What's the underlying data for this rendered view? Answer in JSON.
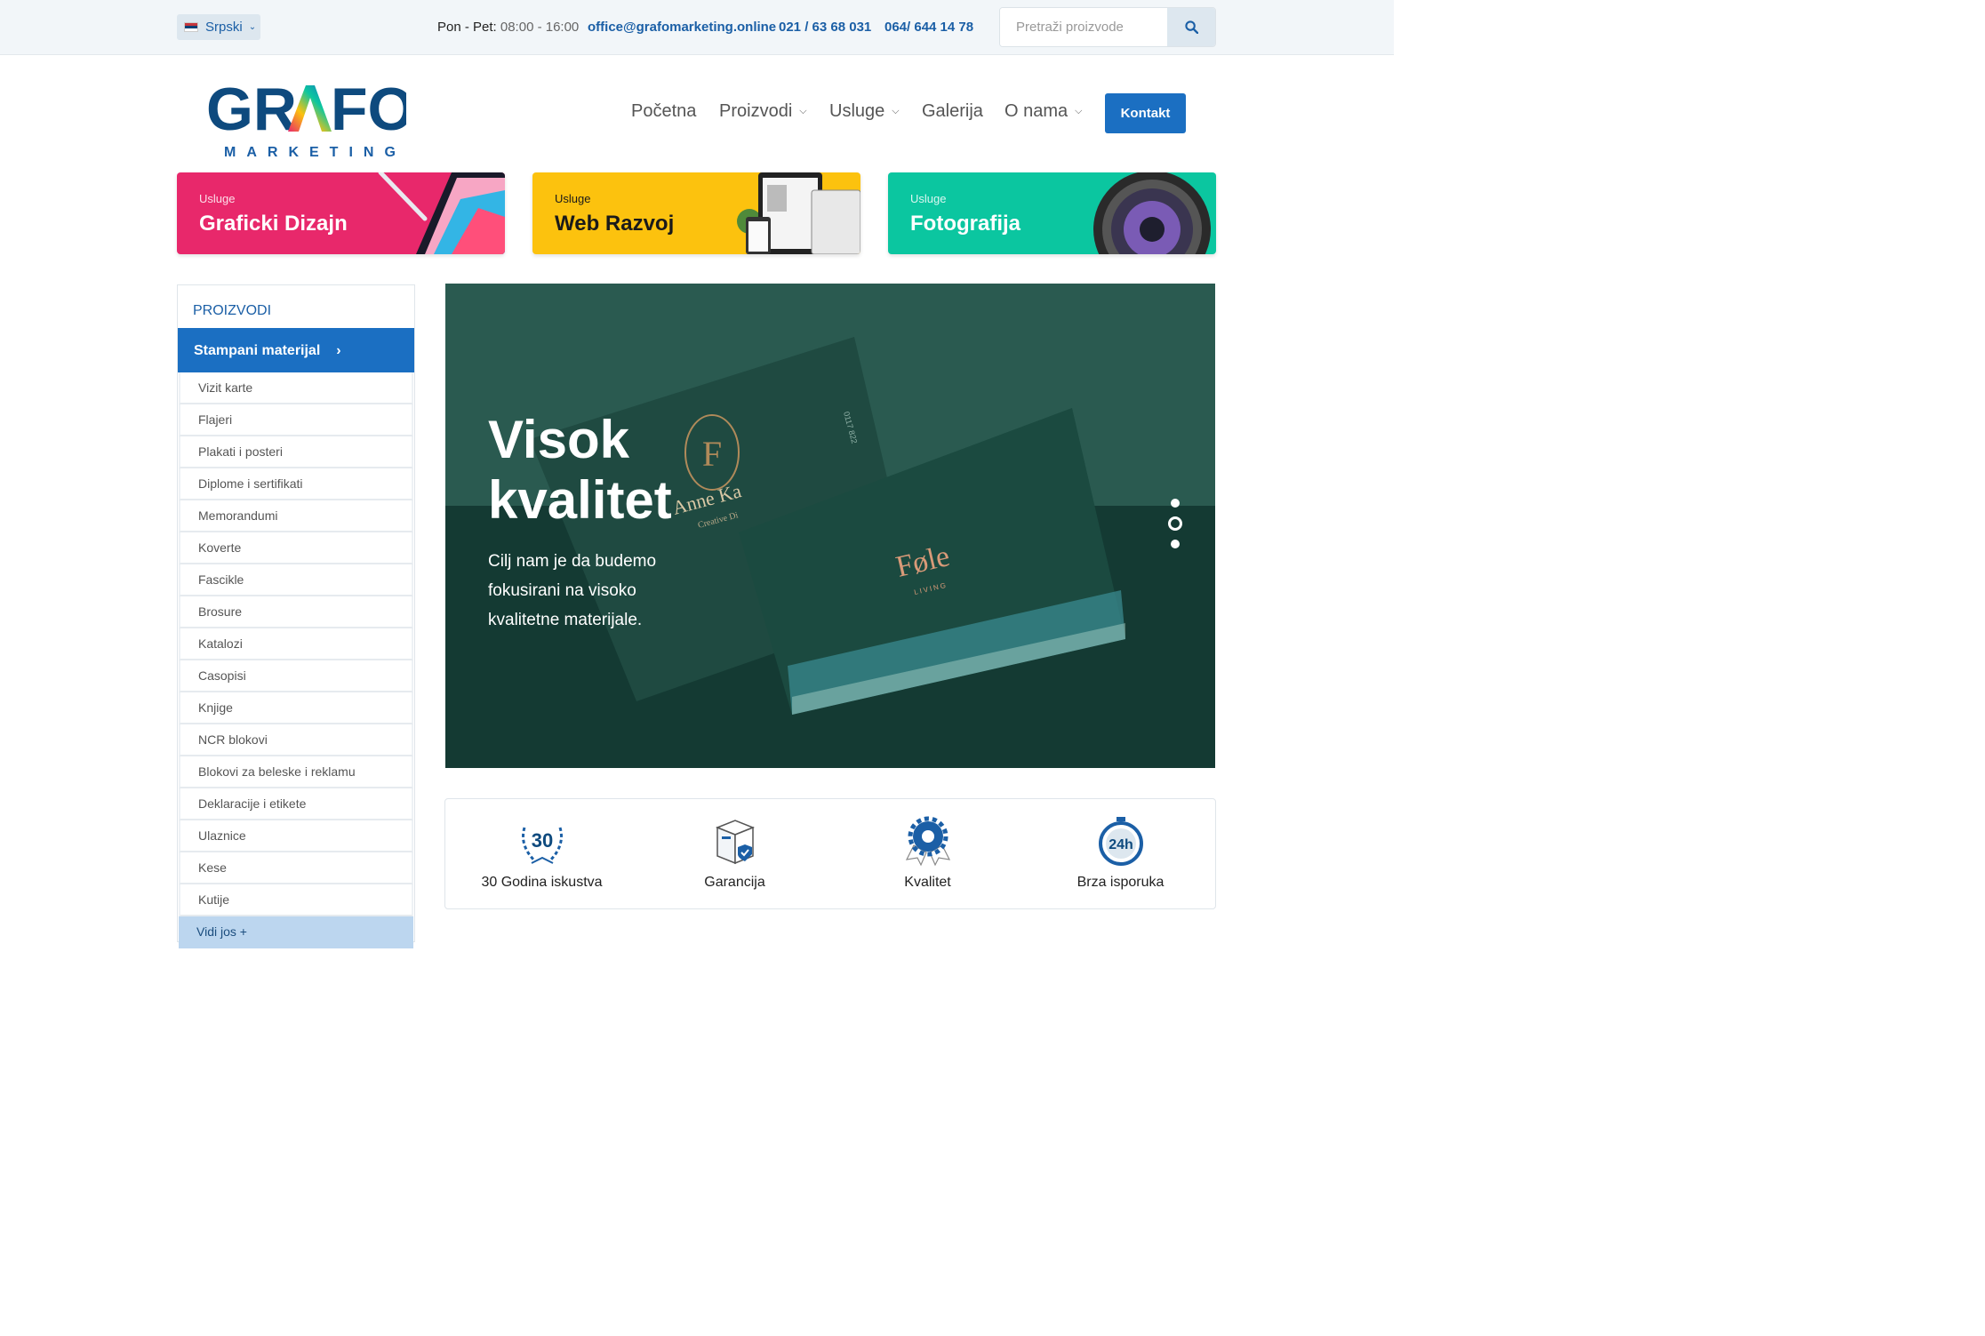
{
  "topbar": {
    "language": "Srpski",
    "hours_label": "Pon - Pet:",
    "hours_time": "08:00 - 16:00",
    "email": "office@grafomarketing.online",
    "phone1": "021 / 63 68 031",
    "phone2": "064/ 644 14 78",
    "search_placeholder": "Pretraži proizvode"
  },
  "logo": {
    "main": "GRAFO",
    "sub": "MARKETING"
  },
  "nav": {
    "items": [
      {
        "label": "Početna"
      },
      {
        "label": "Proizvodi"
      },
      {
        "label": "Usluge"
      },
      {
        "label": "Galerija"
      },
      {
        "label": "O nama"
      }
    ],
    "cta": "Kontakt"
  },
  "cards": [
    {
      "sub": "Usluge",
      "title": "Graficki Dizajn",
      "color": "#e8286b"
    },
    {
      "sub": "Usluge",
      "title": "Web Razvoj",
      "color": "#fcc20e"
    },
    {
      "sub": "Usluge",
      "title": "Fotografija",
      "color": "#0bc6a0"
    }
  ],
  "sidebar": {
    "heading": "PROIZVODI",
    "active": "Stampani materijal",
    "items": [
      "Vizit karte",
      "Flajeri",
      "Plakati i posteri",
      "Diplome i sertifikati",
      "Memorandumi",
      "Koverte",
      "Fascikle",
      "Brosure",
      "Katalozi",
      "Casopisi",
      "Knjige",
      "NCR blokovi",
      "Blokovi za beleske i reklamu",
      "Deklaracije i etikete",
      "Ulaznice",
      "Kese",
      "Kutije"
    ],
    "more": "Vidi jos +"
  },
  "hero": {
    "title_line1": "Visok",
    "title_line2": "kvalitet",
    "text": "Cilj nam je da budemo fokusirani na visoko kvalitetne materijale.",
    "card_name": "Anne Ka",
    "card_role": "Creative Di",
    "card_brand": "Føle",
    "card_brand_sub": "LIVING",
    "card_initial": "F",
    "card_code": "0117 822",
    "slides": 3,
    "active_slide": 2
  },
  "features": [
    {
      "label": "30 Godina iskustva",
      "icon": "laurel-30-icon",
      "badge": "30"
    },
    {
      "label": "Garancija",
      "icon": "box-shield-icon"
    },
    {
      "label": "Kvalitet",
      "icon": "award-gear-icon"
    },
    {
      "label": "Brza isporuka",
      "icon": "stopwatch-24h-icon",
      "badge": "24h"
    }
  ],
  "colors": {
    "brand": "#0e4a7e",
    "accent": "#1b6fc2",
    "hero_bg": "#173c35"
  }
}
